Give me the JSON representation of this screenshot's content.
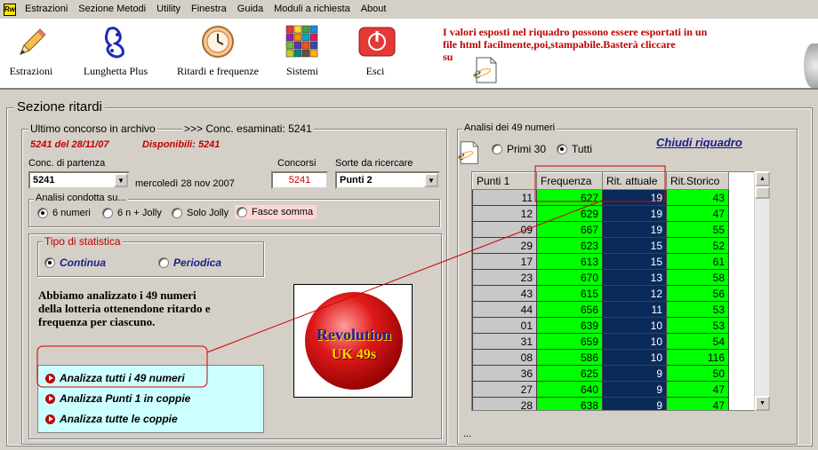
{
  "menubar": {
    "app_icon_label": "Rw",
    "items": [
      "Estrazioni",
      "Sezione Metodi",
      "Utility",
      "Finestra",
      "Guida",
      "Moduli a richiesta",
      "About"
    ]
  },
  "toolbar": {
    "tools": [
      {
        "label": "Estrazioni",
        "icon": "pencil-icon"
      },
      {
        "label": "Lunghetta Plus",
        "icon": "lottery-hand-icon"
      },
      {
        "label": "Ritardi e frequenze",
        "icon": "clock-icon"
      },
      {
        "label": "Sistemi",
        "icon": "grid-colors-icon"
      },
      {
        "label": "Esci",
        "icon": "power-icon"
      }
    ],
    "notice_lines": [
      "I valori esposti nel riquadro possono essere esportati in un",
      "file html facilmente,poi,stampabile.Basterà cliccare",
      "su"
    ]
  },
  "section": {
    "title": "Sezione ritardi",
    "archive_group_title": "Ultimo concorso in archivo",
    "examined": ">>> Conc. esaminati: 5241",
    "last_date": "5241   del 28/11/07",
    "available": "Disponibili: 5241",
    "start_label": "Conc. di partenza",
    "start_value": "5241",
    "start_date": "mercoledì 28 nov 2007",
    "concorsi_label": "Concorsi",
    "concorsi_value": "5241",
    "sorte_label": "Sorte da ricercare",
    "sorte_value": "Punti 2",
    "analysis_group_title": "Analisi condotta su...",
    "analysis_options": [
      {
        "label": "6 numeri",
        "checked": true
      },
      {
        "label": "6 n + Jolly",
        "checked": false
      },
      {
        "label": "Solo Jolly",
        "checked": false
      },
      {
        "label": "Fasce somma",
        "checked": false
      }
    ],
    "stat_group_title": "Tipo di statistica",
    "stat_options": [
      {
        "label": "Continua",
        "checked": true
      },
      {
        "label": "Periodica",
        "checked": false
      }
    ],
    "description_lines": [
      "Abbiamo analizzato i 49 numeri",
      "della lotteria ottenendone ritardo e",
      "frequenza per ciascuno."
    ],
    "actions": [
      "Analizza tutti i 49 numeri",
      "Analizza Punti 1 in coppie",
      "Analizza tutte le coppie"
    ],
    "logo_text_1": "Revolution",
    "logo_text_2": "UK 49s"
  },
  "panel": {
    "group_title": "Analisi dei 49 numeri",
    "scope_options": [
      {
        "label": "Primi 30",
        "checked": false
      },
      {
        "label": "Tutti",
        "checked": true
      }
    ],
    "close_link": "Chiudi riquadro",
    "footer": "...",
    "columns": [
      "Punti 1",
      "Frequenza",
      "Rit. attuale",
      "Rit.Storico"
    ],
    "rows": [
      [
        "11",
        "627",
        "19",
        "43"
      ],
      [
        "12",
        "629",
        "19",
        "47"
      ],
      [
        "09",
        "667",
        "19",
        "55"
      ],
      [
        "29",
        "623",
        "15",
        "52"
      ],
      [
        "17",
        "613",
        "15",
        "61"
      ],
      [
        "23",
        "670",
        "13",
        "58"
      ],
      [
        "43",
        "615",
        "12",
        "56"
      ],
      [
        "44",
        "656",
        "11",
        "53"
      ],
      [
        "01",
        "639",
        "10",
        "53"
      ],
      [
        "31",
        "659",
        "10",
        "54"
      ],
      [
        "08",
        "586",
        "10",
        "116"
      ],
      [
        "36",
        "625",
        "9",
        "50"
      ],
      [
        "27",
        "640",
        "9",
        "47"
      ],
      [
        "28",
        "638",
        "9",
        "47"
      ]
    ]
  },
  "colors": {
    "accent_red": "#c00000",
    "freq_green": "#00ff00",
    "delay_navy": "#0a2a5a",
    "link_navy": "#1d1d8a",
    "analyze_bg": "#ccffff"
  }
}
